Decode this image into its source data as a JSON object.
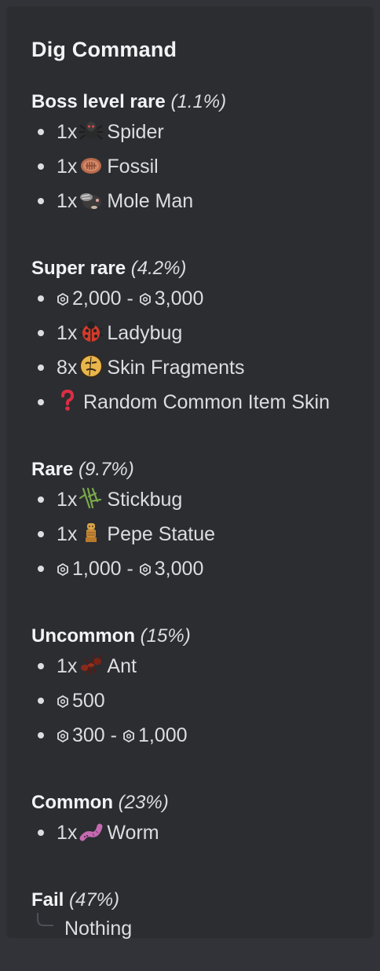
{
  "embed": {
    "title": "Dig Command",
    "sections": [
      {
        "name": "Boss level rare",
        "pct": "(1.1%)",
        "items": [
          {
            "qty": "1x",
            "icon": "spider-icon",
            "label": "Spider"
          },
          {
            "qty": "1x",
            "icon": "fossil-icon",
            "label": "Fossil"
          },
          {
            "qty": "1x",
            "icon": "mole-man-icon",
            "label": "Mole Man"
          }
        ]
      },
      {
        "name": "Super rare",
        "pct": "(4.2%)",
        "items": [
          {
            "coin_from": "2,000",
            "sep": " - ",
            "coin_to": "3,000"
          },
          {
            "qty": "1x",
            "icon": "ladybug-icon",
            "label": "Ladybug"
          },
          {
            "qty": "8x",
            "icon": "skin-fragment-icon",
            "label": "Skin Fragments"
          },
          {
            "icon": "question-mark-icon",
            "label": "Random Common Item Skin"
          }
        ]
      },
      {
        "name": "Rare",
        "pct": "(9.7%)",
        "items": [
          {
            "qty": "1x",
            "icon": "stickbug-icon",
            "label": "Stickbug"
          },
          {
            "qty": "1x",
            "icon": "pepe-statue-icon",
            "label": "Pepe Statue"
          },
          {
            "coin_from": "1,000",
            "sep": " - ",
            "coin_to": "3,000"
          }
        ]
      },
      {
        "name": "Uncommon",
        "pct": "(15%)",
        "items": [
          {
            "qty": "1x",
            "icon": "ant-icon",
            "label": "Ant"
          },
          {
            "coin_from": "500"
          },
          {
            "coin_from": "300",
            "sep": " - ",
            "coin_to": "1,000"
          }
        ]
      },
      {
        "name": "Common",
        "pct": "(23%)",
        "items": [
          {
            "qty": "1x",
            "icon": "worm-icon",
            "label": "Worm"
          }
        ]
      },
      {
        "name": "Fail",
        "pct": "(47%)",
        "result": "Nothing"
      }
    ],
    "colors": {
      "background": "#313338",
      "embed_bg": "#2b2d31",
      "text": "#dbdee1",
      "heading": "#f2f3f5"
    }
  }
}
